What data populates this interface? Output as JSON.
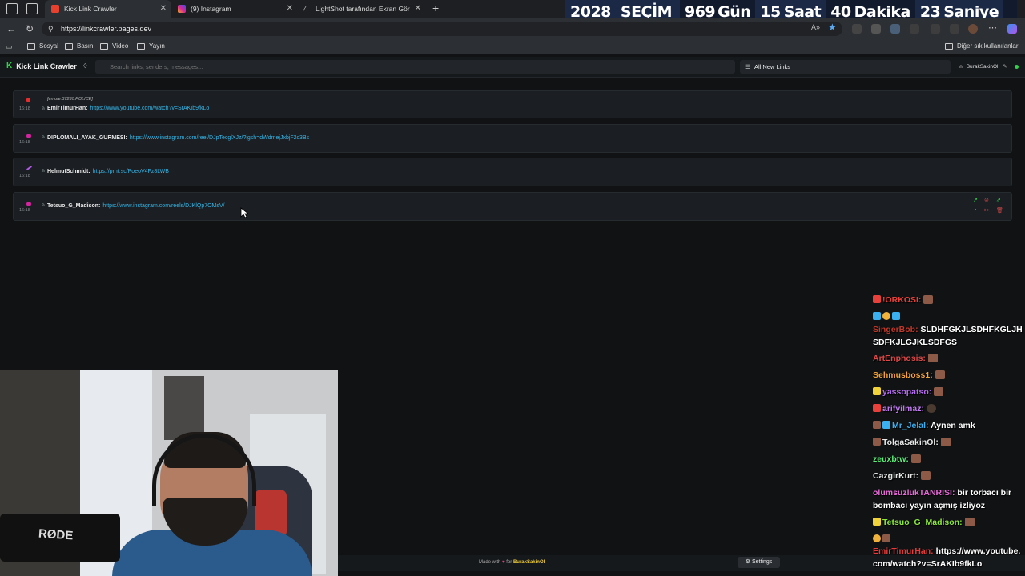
{
  "browser": {
    "tabs": [
      {
        "label": "Kick Link Crawler",
        "active": true
      },
      {
        "label": "(9) Instagram",
        "active": false
      },
      {
        "label": "LightShot tarafından Ekran Görün",
        "active": false
      }
    ],
    "new_tab": "+",
    "url": "https://linkcrawler.pages.dev",
    "bookmarks": [
      "Sosyal",
      "Basın",
      "Video",
      "Yayın"
    ],
    "other_bookmarks": "Diğer sık kullanılanlar"
  },
  "countdown": {
    "year": "2028",
    "label": "SEÇİM",
    "days": "969",
    "days_unit": "Gün",
    "hours": "15",
    "hours_unit": "Saat",
    "minutes": "40",
    "minutes_unit": "Dakika",
    "seconds": "23",
    "seconds_unit": "Saniye"
  },
  "app": {
    "title": "Kick Link Crawler",
    "search_placeholder": "Search links, senders, messages...",
    "filter_label": "All New Links",
    "username": "BurakSakinOl"
  },
  "links": [
    {
      "time": "16:18",
      "platform": "youtube",
      "emote": "[emote:37230:POLICE]",
      "sender": "EmirTimurHan:",
      "url": "https://www.youtube.com/watch?v=SrAKIb9fkLo"
    },
    {
      "time": "16:18",
      "platform": "instagram",
      "emote": "",
      "sender": "DIPLOMALI_AYAK_GURMESI:",
      "url": "https://www.instagram.com/reel/DJpTecglXJz/?igsh=dWdmejJxbjF2c3Bs"
    },
    {
      "time": "16:18",
      "platform": "lightshot",
      "emote": "",
      "sender": "HelmutSchmidt:",
      "url": "https://prnt.sc/PoeoV4Fz8LWB"
    },
    {
      "time": "16:18",
      "platform": "instagram",
      "emote": "",
      "sender": "Tetsuo_G_Madison:",
      "url": "https://www.instagram.com/reels/DJKlQp7OMsV/"
    }
  ],
  "footer": {
    "made_with": "Made with",
    "for": "for",
    "author": "BurakSakinOl",
    "settings": "Settings"
  },
  "chat": [
    {
      "user": "!ORKOSI:",
      "color": "#e8403a",
      "message": ""
    },
    {
      "user": "SingerBob:",
      "color": "#c0392b",
      "message": "SLDHFGKJLSDHFKGLJHSDFKJLGJKLSDFGS"
    },
    {
      "user": "ArtEnphosis:",
      "color": "#e04848",
      "message": ""
    },
    {
      "user": "Sehmusboss1:",
      "color": "#f2a53a",
      "message": ""
    },
    {
      "user": "yassopatso:",
      "color": "#b56cf0",
      "message": ""
    },
    {
      "user": "arifyilmaz:",
      "color": "#c07af0",
      "message": ""
    },
    {
      "user": "Mr_Jelal:",
      "color": "#3ab0f0",
      "message": "Aynen amk"
    },
    {
      "user": "TolgaSakinOl:",
      "color": "#e8e8e8",
      "message": ""
    },
    {
      "user": "zeuxbtw:",
      "color": "#5ef07a",
      "message": ""
    },
    {
      "user": "CazgirKurt:",
      "color": "#e8e8e8",
      "message": ""
    },
    {
      "user": "olumsuzlukTANRISI:",
      "color": "#e86ad8",
      "message": "bir torbacı bir bombacı yayın açmış izliyoz"
    },
    {
      "user": "Tetsuo_G_Madison:",
      "color": "#8ae83a",
      "message": ""
    },
    {
      "user": "EmirTimurHan:",
      "color": "#e83a3a",
      "message": "https://www.youtube.com/watch?v=SrAKIb9fkLo"
    }
  ],
  "colors": {
    "accent": "#2ed34a",
    "link": "#35b6e8",
    "background": "#101214"
  }
}
